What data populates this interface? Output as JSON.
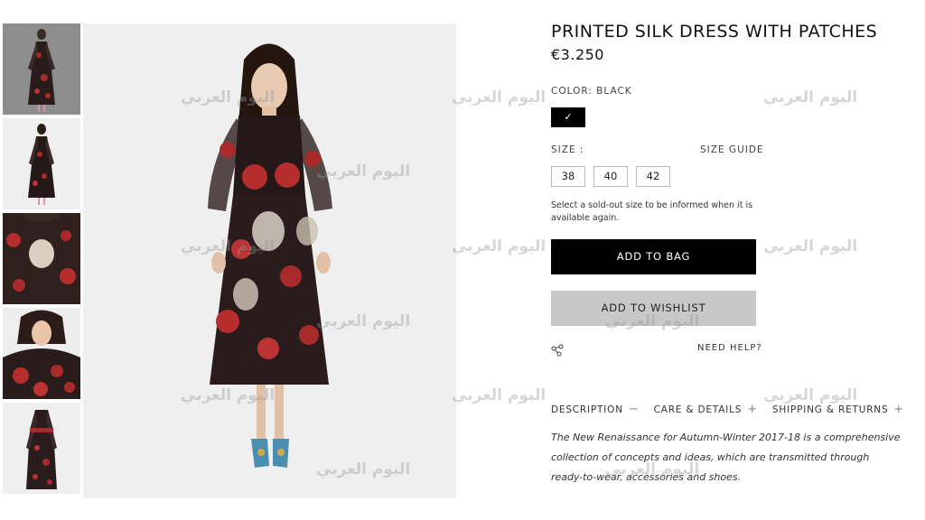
{
  "product": {
    "title": "PRINTED SILK DRESS WITH PATCHES",
    "price": "€3.250"
  },
  "color": {
    "label": "COLOR:  BLACK",
    "swatch_value": "#000000",
    "selected_icon": "checkmark-icon",
    "check_glyph": "✓"
  },
  "size": {
    "label": "SIZE :",
    "guide": "SIZE GUIDE",
    "options": [
      "38",
      "40",
      "42"
    ],
    "notify_text": "Select a sold-out size to be informed when it is available again."
  },
  "actions": {
    "add_to_bag": "ADD TO BAG",
    "add_to_wishlist": "ADD TO WISHLIST",
    "share_icon": "share-icon",
    "need_help": "NEED HELP?"
  },
  "tabs": [
    {
      "label": "DESCRIPTION",
      "sign": "−"
    },
    {
      "label": "CARE & DETAILS",
      "sign": "+"
    },
    {
      "label": "SHIPPING & RETURNS",
      "sign": "+"
    }
  ],
  "description": "The New Renaissance for Autumn-Winter 2017-18 is a comprehensive collection of concepts and ideas, which are transmitted through ready-to-wear, accessories and shoes.",
  "watermark_text": "اليوم العربي",
  "colors": {
    "primary_button": "#000000",
    "secondary_button": "#c8c8c8",
    "image_background": "#efefef",
    "active_thumb": "#8d8d8d"
  }
}
